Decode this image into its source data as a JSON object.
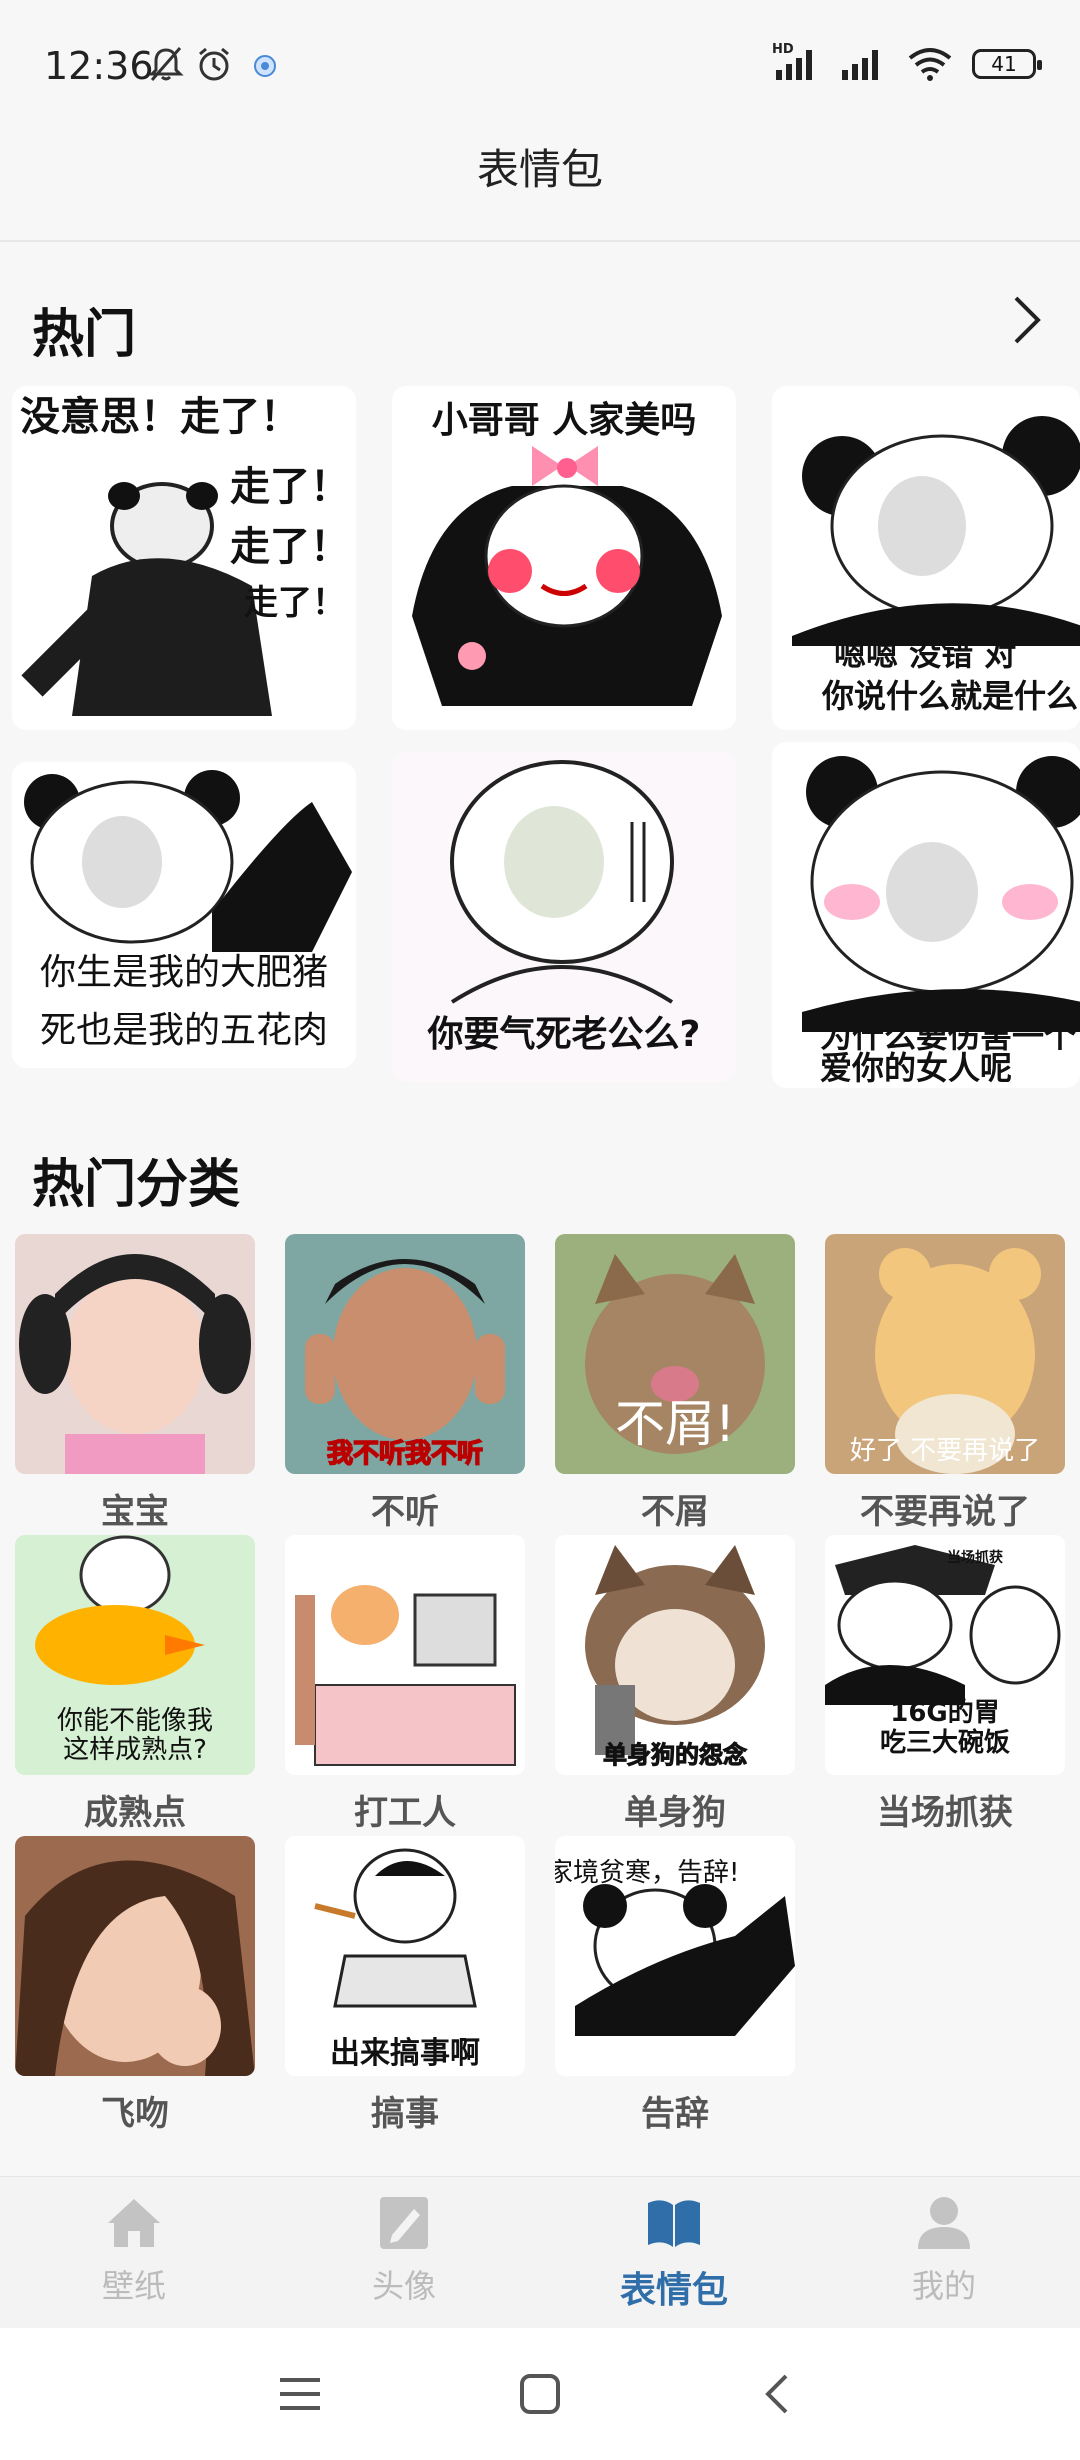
{
  "status_bar": {
    "time": "12:36",
    "network": "HD",
    "battery": "41"
  },
  "header": {
    "title": "表情包"
  },
  "hot": {
    "title": "热门",
    "memes": [
      {
        "lines": [
          "没意思！走了！",
          "走了！",
          "走了！",
          "走了！"
        ]
      },
      {
        "lines": [
          "小哥哥 人家美吗"
        ]
      },
      {
        "lines": [
          "嗯嗯 没错 对",
          "你说什么就是什么"
        ]
      },
      {
        "lines": [
          "你生是我的大肥猪",
          "死也是我的五花肉"
        ]
      },
      {
        "lines": [
          "你要气死老公么?"
        ]
      },
      {
        "lines": [
          "为什么要伤害一个",
          "爱你的女人呢"
        ]
      }
    ]
  },
  "categories": {
    "title": "热门分类",
    "items": [
      {
        "label": "宝宝",
        "overlay": ""
      },
      {
        "label": "不听",
        "overlay": "我不听我不听"
      },
      {
        "label": "不屑",
        "overlay": "不屑!"
      },
      {
        "label": "不要再说了",
        "overlay": "好了 不要再说了"
      },
      {
        "label": "成熟点",
        "overlay": "你能不能像我\n这样成熟点?"
      },
      {
        "label": "打工人",
        "overlay": ""
      },
      {
        "label": "单身狗",
        "overlay": "单身狗的怨念"
      },
      {
        "label": "当场抓获",
        "overlay": "16G的胃\n吃三大碗饭",
        "tag": "当场抓获"
      },
      {
        "label": "飞吻",
        "overlay": ""
      },
      {
        "label": "搞事",
        "overlay": "出来搞事啊"
      },
      {
        "label": "告辞",
        "overlay": "家境贫寒，告辞!"
      }
    ]
  },
  "bottom_nav": {
    "items": [
      {
        "label": "壁纸",
        "icon": "home-icon",
        "active": false
      },
      {
        "label": "头像",
        "icon": "edit-icon",
        "active": false
      },
      {
        "label": "表情包",
        "icon": "book-icon",
        "active": true
      },
      {
        "label": "我的",
        "icon": "user-icon",
        "active": false
      }
    ]
  },
  "colors": {
    "accent": "#2f6ea8",
    "inactive": "#bbbbbb",
    "background": "#f7f7f7"
  }
}
